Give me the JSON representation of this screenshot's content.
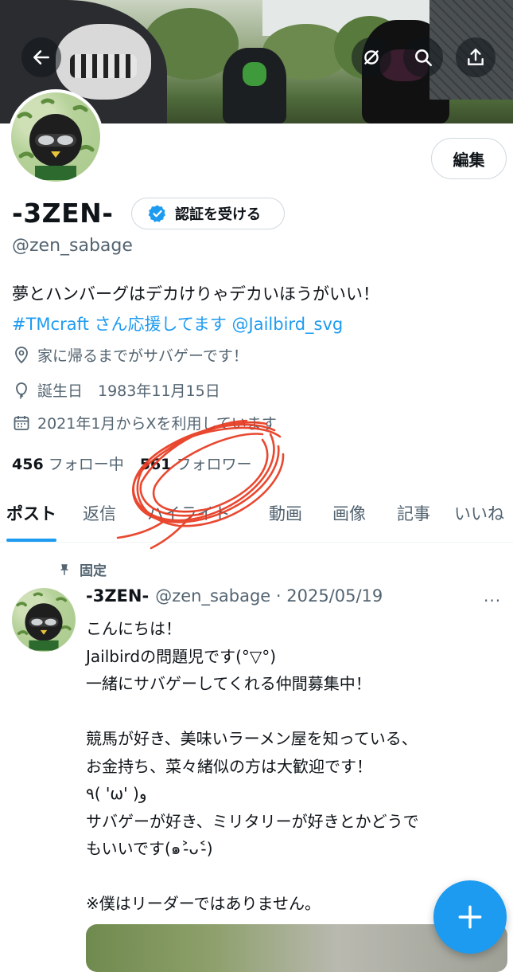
{
  "header": {
    "back_icon": "arrow-left-icon",
    "actions": [
      "grok-icon",
      "search-icon",
      "share-icon"
    ]
  },
  "profile": {
    "edit_label": "編集",
    "name": "-3ZEN-",
    "verify_label": "認証を受ける",
    "handle": "@zen_sabage",
    "bio_line1": "夢とハンバーグはデカけりゃデカいほうがいい！",
    "bio_hashtag": "#TMcraft",
    "bio_middle": " さん応援してます ",
    "bio_mention": "@Jailbird_svg",
    "location": "家に帰るまでがサバゲーです！",
    "birthday": "誕生日　1983年11月15日",
    "joined": "2021年1月からXを利用しています",
    "following_count": "456",
    "following_label": "フォロー中",
    "followers_count": "561",
    "followers_label": "フォロワー"
  },
  "tabs": [
    "ポスト",
    "返信",
    "ハイライト",
    "動画",
    "画像",
    "記事",
    "いいね"
  ],
  "post": {
    "pinned_label": "固定",
    "author": "-3ZEN-",
    "handle_date": "@zen_sabage · 2025/05/19",
    "more": "···",
    "body": "こんにちは！\nJailbirdの問題児です(°▽°)\n一緒にサバゲーしてくれる仲間募集中！\n\n競馬が好き、美味いラーメン屋を知っている、\nお金持ち、菜々緒似の方は大歓迎です！\n٩( 'ω' )و\nサバゲーが好き、ミリタリーが好きとかどうで\nもいいです(๑˃̵ᴗ˂̵)\n\n※僕はリーダーではありません。"
  },
  "colors": {
    "accent": "#1d9bf0",
    "text": "#0f1419",
    "muted": "#536471",
    "annotation": "#e8391f"
  }
}
